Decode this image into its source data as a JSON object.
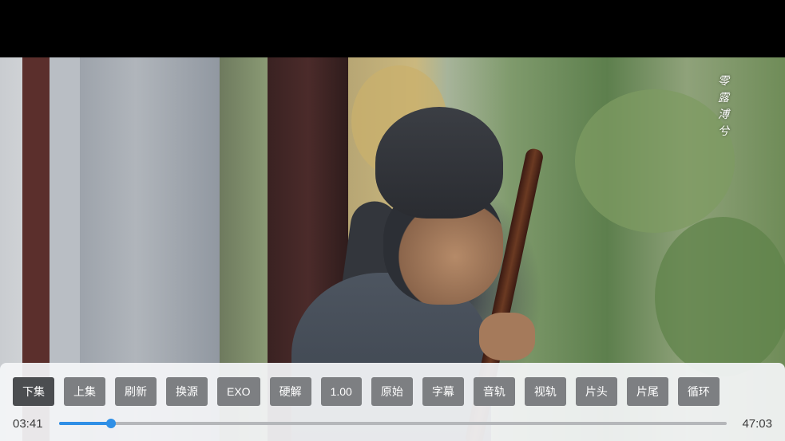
{
  "subtitle": {
    "text": "零露溥兮"
  },
  "controls": {
    "buttons": [
      {
        "id": "next-episode",
        "label": "下集",
        "active": true
      },
      {
        "id": "prev-episode",
        "label": "上集"
      },
      {
        "id": "refresh",
        "label": "刷新"
      },
      {
        "id": "switch-source",
        "label": "换源"
      },
      {
        "id": "player-engine",
        "label": "EXO"
      },
      {
        "id": "decode-mode",
        "label": "硬解"
      },
      {
        "id": "playback-speed",
        "label": "1.00"
      },
      {
        "id": "aspect-ratio",
        "label": "原始"
      },
      {
        "id": "subtitles",
        "label": "字幕"
      },
      {
        "id": "audio-track",
        "label": "音轨"
      },
      {
        "id": "video-track",
        "label": "视轨"
      },
      {
        "id": "skip-opening",
        "label": "片头"
      },
      {
        "id": "skip-ending",
        "label": "片尾"
      },
      {
        "id": "loop",
        "label": "循环"
      }
    ]
  },
  "progress": {
    "current_time": "03:41",
    "total_time": "47:03",
    "fraction": 0.0783,
    "accent_color": "#2f8fe6"
  }
}
